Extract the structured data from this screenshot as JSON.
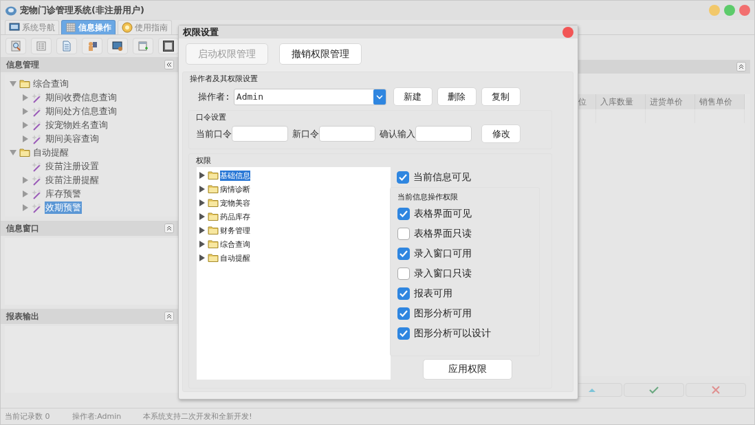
{
  "window": {
    "title": "宠物门诊管理系统(非注册用户)"
  },
  "tabs": [
    {
      "label": "系统导航",
      "selected": false
    },
    {
      "label": "信息操作",
      "selected": true
    },
    {
      "label": "使用指南",
      "selected": false
    }
  ],
  "sidebar": {
    "sections": [
      {
        "title": "信息管理",
        "tree": [
          {
            "label": "综合查询",
            "kind": "folder",
            "expanded": true,
            "selected": false,
            "children": [
              {
                "label": "期间收费信息查询",
                "kind": "query",
                "expanded": false,
                "selected": false
              },
              {
                "label": "期间处方信息查询",
                "kind": "query",
                "expanded": false,
                "selected": false
              },
              {
                "label": "按宠物姓名查询",
                "kind": "query",
                "expanded": false,
                "selected": false
              },
              {
                "label": "期间美容查询",
                "kind": "query",
                "expanded": false,
                "selected": false
              }
            ]
          },
          {
            "label": "自动提醒",
            "kind": "folder",
            "expanded": true,
            "selected": false,
            "children": [
              {
                "label": "疫苗注册设置",
                "kind": "leaf",
                "selected": false
              },
              {
                "label": "疫苗注册提醒",
                "kind": "query",
                "expanded": false,
                "selected": false
              },
              {
                "label": "库存预警",
                "kind": "query",
                "expanded": false,
                "selected": false
              },
              {
                "label": "效期预警",
                "kind": "query",
                "expanded": false,
                "selected": true
              }
            ]
          }
        ]
      },
      {
        "title": "信息窗口"
      },
      {
        "title": "报表输出"
      }
    ]
  },
  "table": {
    "columns": [
      "位",
      "入库数量",
      "进货单价",
      "销售单价"
    ]
  },
  "dialog": {
    "title": "权限设置",
    "top_buttons": [
      {
        "label": "启动权限管理",
        "disabled": true
      },
      {
        "label": "撤销权限管理",
        "disabled": false
      }
    ],
    "operator_group": {
      "title": "操作者及其权限设置",
      "operator_label": "操作者:",
      "operator_value": "Admin",
      "buttons": [
        "新建",
        "删除",
        "复制"
      ]
    },
    "password_group": {
      "title": "口令设置",
      "fields": [
        {
          "label": "当前口令"
        },
        {
          "label": "新口令"
        },
        {
          "label": "确认输入"
        }
      ],
      "button": "修改"
    },
    "permissions": {
      "title": "权限",
      "tree": [
        {
          "label": "基础信息",
          "expanded": false,
          "selected": true
        },
        {
          "label": "病情诊断",
          "expanded": false,
          "selected": false
        },
        {
          "label": "宠物美容",
          "expanded": false,
          "selected": false
        },
        {
          "label": "药品库存",
          "expanded": false,
          "selected": false
        },
        {
          "label": "财务管理",
          "expanded": false,
          "selected": false
        },
        {
          "label": "综合查询",
          "expanded": false,
          "selected": false
        },
        {
          "label": "自动提醒",
          "expanded": false,
          "selected": false
        }
      ],
      "visible": {
        "label": "当前信息可见",
        "checked": true
      },
      "ops_title": "当前信息操作权限",
      "ops": [
        {
          "label": "表格界面可见",
          "checked": true
        },
        {
          "label": "表格界面只读",
          "checked": false
        },
        {
          "label": "录入窗口可用",
          "checked": true
        },
        {
          "label": "录入窗口只读",
          "checked": false
        },
        {
          "label": "报表可用",
          "checked": true
        },
        {
          "label": "图形分析可用",
          "checked": true
        },
        {
          "label": "图形分析可以设计",
          "checked": true
        }
      ],
      "apply_button": "应用权限"
    }
  },
  "status_bar": [
    "当前记录数 0",
    "操作者:Admin",
    "本系统支持二次开发和全新开发!"
  ]
}
